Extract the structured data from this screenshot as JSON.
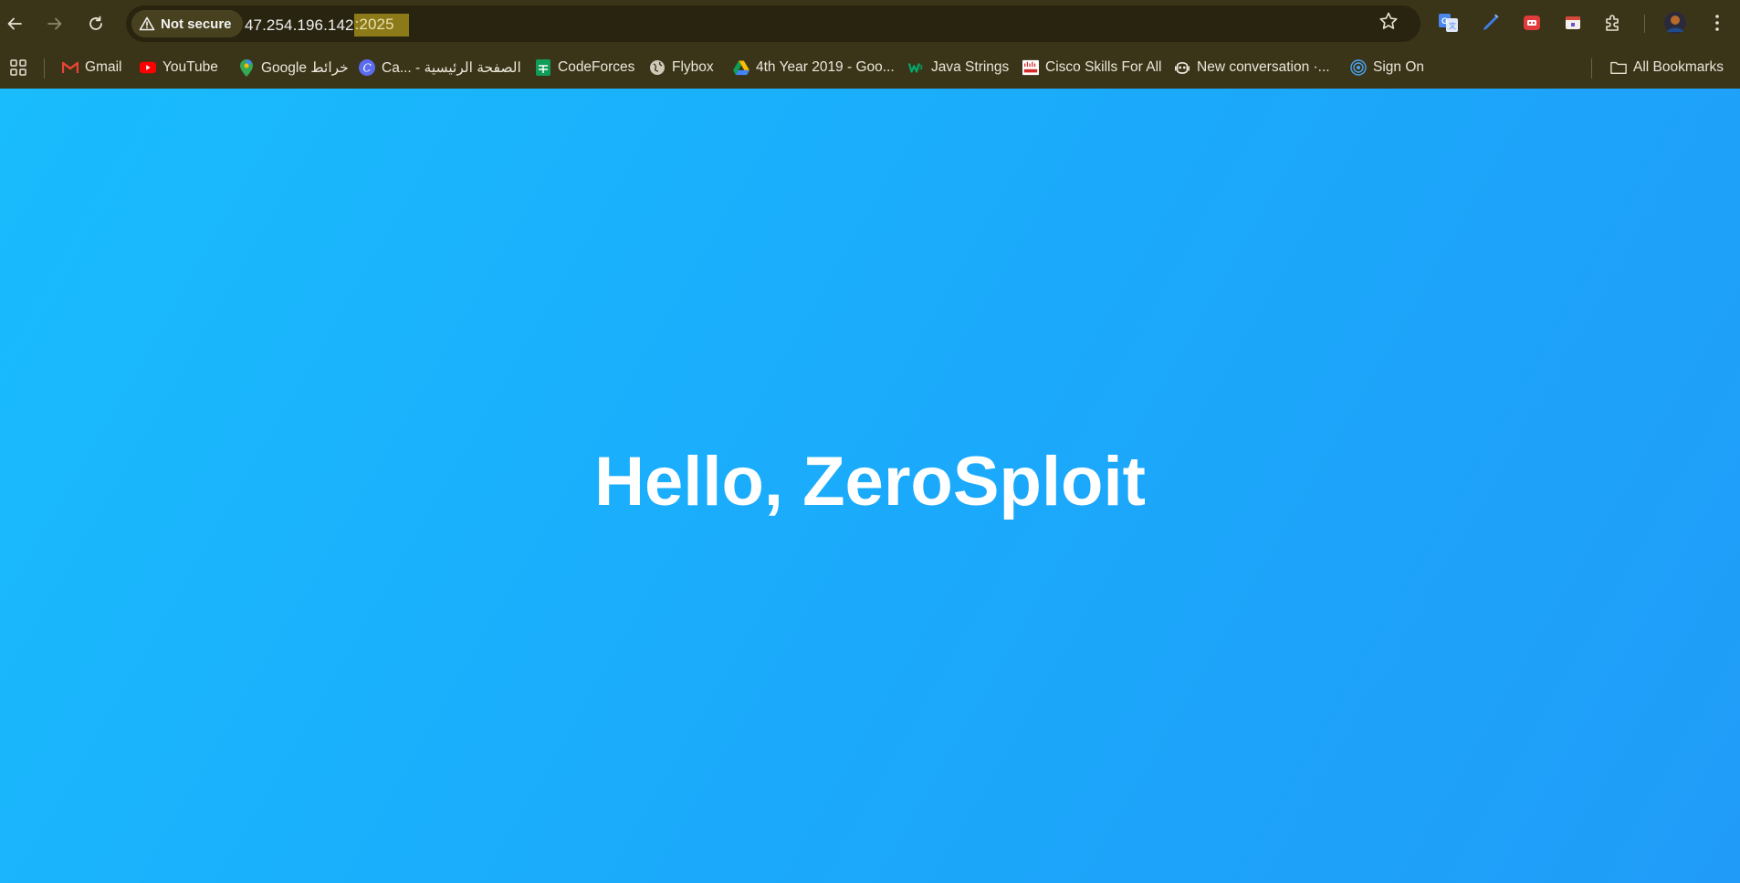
{
  "browser": {
    "security_label": "Not secure",
    "url_host": "47.254.196.142",
    "url_port": ":2025"
  },
  "bookmarks": [
    {
      "label": "Gmail",
      "icon": "gmail-icon"
    },
    {
      "label": "YouTube",
      "icon": "youtube-icon"
    },
    {
      "label": "Google خرائط",
      "icon": "google-maps-icon"
    },
    {
      "label": "Ca... - الصفحة الرئيسية",
      "icon": "canva-icon"
    },
    {
      "label": "CodeForces",
      "icon": "google-sheets-icon"
    },
    {
      "label": "Flybox",
      "icon": "globe-icon"
    },
    {
      "label": "4th Year 2019 - Goo...",
      "icon": "google-drive-icon"
    },
    {
      "label": "Java Strings",
      "icon": "w3schools-icon"
    },
    {
      "label": "Cisco Skills For All",
      "icon": "cisco-icon"
    },
    {
      "label": "New conversation ·...",
      "icon": "copilot-icon"
    },
    {
      "label": "Sign On",
      "icon": "fingerprint-icon"
    }
  ],
  "all_bookmarks_label": "All Bookmarks",
  "page": {
    "heading": "Hello, ZeroSploit"
  },
  "colors": {
    "toolbar_bg": "#3a3419",
    "page_gradient_start": "#19bcfd",
    "page_gradient_end": "#209cf8",
    "heading_color": "#ffffff"
  }
}
